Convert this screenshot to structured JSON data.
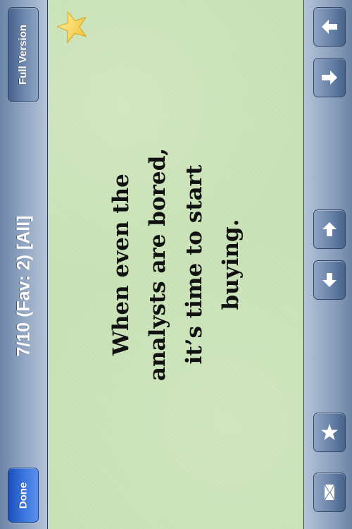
{
  "toolbar": {
    "full_version_label": "Full Version",
    "title": "7/10 (Fav: 2) [All]",
    "done_label": "Done"
  },
  "quote": {
    "text": "When even the analysts are bored, it’s time to start buying.",
    "is_favorite": true
  },
  "side_controls": {
    "icons": [
      "previous-arrow-icon",
      "next-arrow-icon",
      "scroll-up-arrow-icon",
      "scroll-down-arrow-icon",
      "star-icon",
      "mail-icon"
    ]
  },
  "colors": {
    "card_background": "#c9e2b5",
    "toolbar": "#8ea3c0",
    "done_button": "#3d78e0",
    "favorite_star": "#f7d24a"
  }
}
